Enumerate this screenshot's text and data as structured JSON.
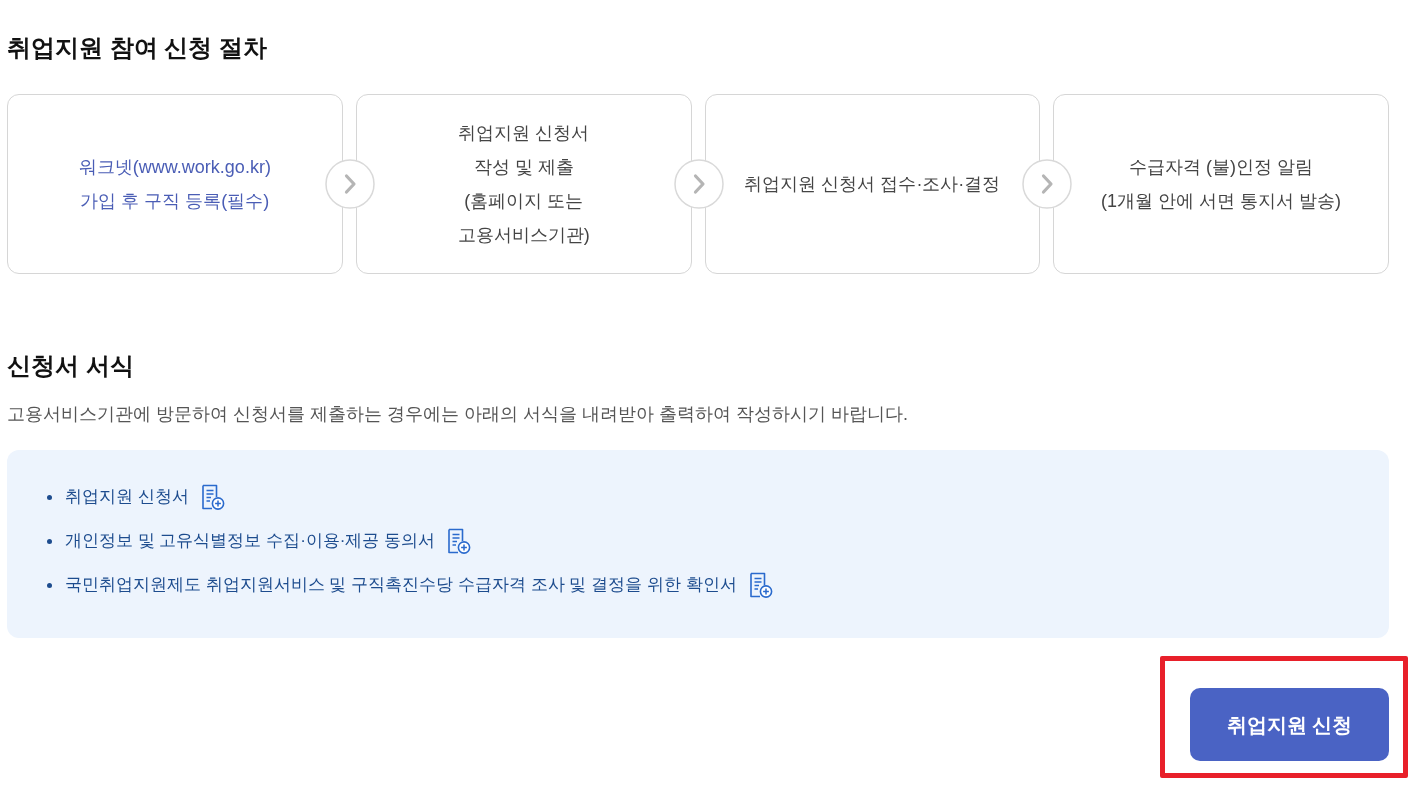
{
  "procedure": {
    "title": "취업지원 참여 신청 절차",
    "steps": [
      {
        "kind": "link",
        "text": "워크넷(www.work.go.kr)\n가입 후 구직 등록(필수)"
      },
      {
        "kind": "text",
        "text": "취업지원 신청서\n작성 및 제출\n(홈페이지 또는\n고용서비스기관)"
      },
      {
        "kind": "text",
        "text": "취업지원 신청서 접수·조사·결정"
      },
      {
        "kind": "text",
        "text": "수급자격 (불)인정 알림\n(1개월 안에 서면 통지서 발송)"
      }
    ]
  },
  "forms": {
    "title": "신청서 서식",
    "description": "고용서비스기관에 방문하여 신청서를 제출하는 경우에는 아래의 서식을 내려받아 출력하여 작성하시기 바랍니다.",
    "items": [
      {
        "label": "취업지원 신청서"
      },
      {
        "label": "개인정보 및 고유식별정보 수집·이용·제공 동의서"
      },
      {
        "label": "국민취업지원제도 취업지원서비스 및 구직촉진수당 수급자격 조사 및 결정을 위한 확인서"
      }
    ]
  },
  "apply_button": {
    "label": "취업지원 신청",
    "highlighted": true
  }
}
